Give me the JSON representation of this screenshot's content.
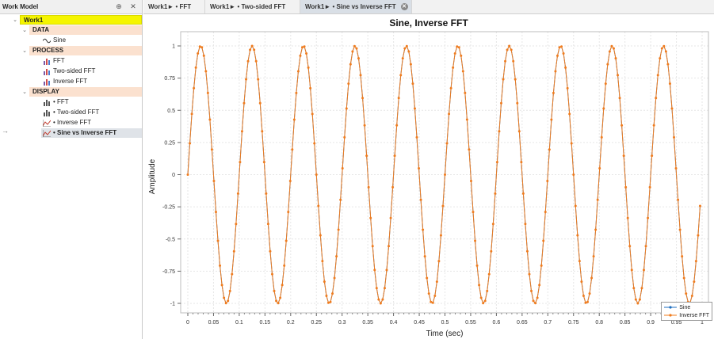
{
  "panel": {
    "title": "Work Model",
    "pin_glyph": "⊕",
    "close_glyph": "✕",
    "root": "Work1",
    "sections": [
      {
        "label": "DATA",
        "items": [
          {
            "label": "Sine",
            "icon": "sine-wave-icon"
          }
        ]
      },
      {
        "label": "PROCESS",
        "items": [
          {
            "label": "FFT",
            "icon": "bar-chart-icon"
          },
          {
            "label": "Two-sided FFT",
            "icon": "bar-chart-icon"
          },
          {
            "label": "Inverse FFT",
            "icon": "bar-chart-icon"
          }
        ]
      },
      {
        "label": "DISPLAY",
        "items": [
          {
            "label": "• FFT",
            "icon": "bar-chart-icon"
          },
          {
            "label": "• Two-sided FFT",
            "icon": "bar-chart-icon"
          },
          {
            "label": "• Inverse FFT",
            "icon": "line-chart-icon"
          },
          {
            "label": "• Sine vs Inverse FFT",
            "icon": "line-chart-icon",
            "selected": true
          }
        ]
      }
    ],
    "current_arrow": "→"
  },
  "tabs": [
    {
      "label": "Work1► • FFT"
    },
    {
      "label": "Work1► • Two-sided FFT"
    },
    {
      "label": "Work1► • Sine vs Inverse FFT",
      "active": true,
      "close": "✕"
    }
  ],
  "colors": {
    "sine": "#1f6fc0",
    "inverse": "#f07c1e",
    "root_bg": "#f5f500",
    "section_bg": "#fbe1cf"
  },
  "chart_data": {
    "type": "line",
    "title": "Sine, Inverse FFT",
    "xlabel": "Time (sec)",
    "ylabel": "Amplitude",
    "xlim": [
      0,
      1
    ],
    "ylim": [
      -1,
      1
    ],
    "x_ticks": [
      "0",
      "0.05",
      "0.1",
      "0.15",
      "0.2",
      "0.25",
      "0.3",
      "0.35",
      "0.4",
      "0.45",
      "0.5",
      "0.55",
      "0.6",
      "0.65",
      "0.7",
      "0.75",
      "0.8",
      "0.85",
      "0.9",
      "0.95",
      "1"
    ],
    "y_ticks": [
      "1",
      "0.75",
      "0.5",
      "0.25",
      "0",
      "-0.25",
      "-0.5",
      "-0.75",
      "-1"
    ],
    "grid": true,
    "legend_position": "bottom-right",
    "frequency_hz": 10,
    "sample_count": 256,
    "series": [
      {
        "name": "Sine",
        "color": "#1f6fc0",
        "formula": "sin(2*pi*10*t)"
      },
      {
        "name": "Inverse FFT",
        "color": "#f07c1e",
        "formula": "sin(2*pi*10*t)"
      }
    ]
  }
}
